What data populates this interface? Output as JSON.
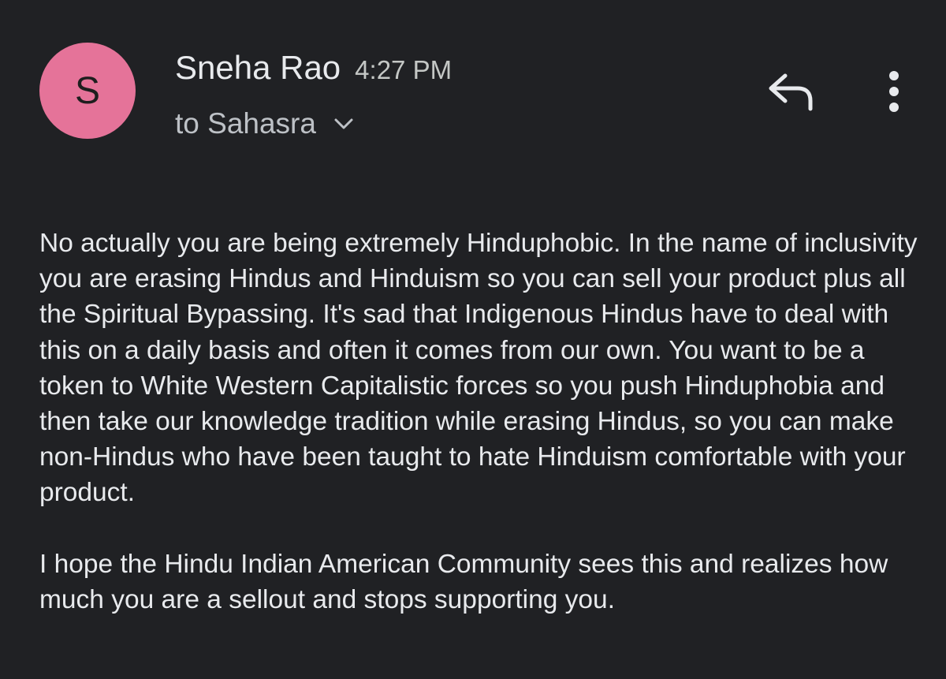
{
  "sender": {
    "avatar_letter": "S",
    "avatar_color": "#e57399",
    "name": "Sneha Rao",
    "time": "4:27 PM"
  },
  "recipient": {
    "text": "to Sahasra"
  },
  "actions": {
    "reply_icon": "reply-icon",
    "more_icon": "more-vertical-icon",
    "expand_icon": "chevron-down-icon"
  },
  "message": {
    "paragraphs": [
      "No actually you are being extremely Hinduphobic. In the name of inclusivity you are erasing Hindus and Hinduism so you can sell your product plus all the Spiritual Bypassing. It's sad that Indigenous Hindus have to deal with this on a daily basis and often it comes from our own. You want to be a token to White Western Capitalistic forces so you push Hinduphobia and then take our knowledge tradition while erasing Hindus, so you can make non-Hindus who have been taught to hate Hinduism comfortable with your product.",
      "I hope the Hindu Indian American Community sees this and realizes how much you are a sellout and stops supporting you."
    ]
  }
}
